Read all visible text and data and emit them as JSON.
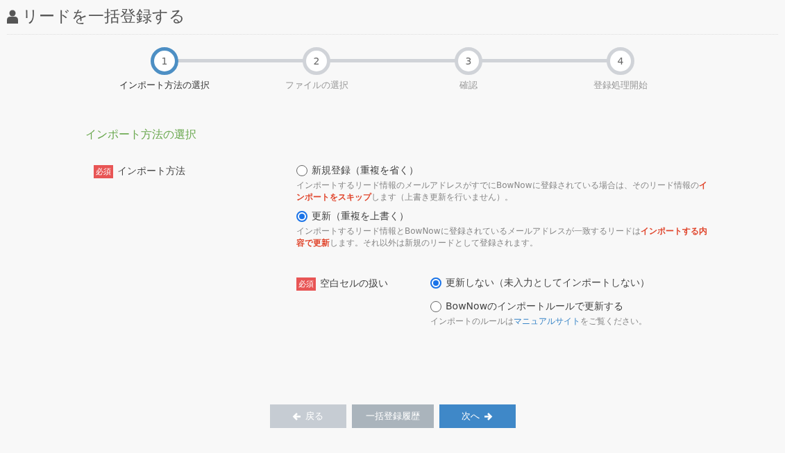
{
  "page_title": "リードを一括登録する",
  "steps": [
    {
      "number": "1",
      "label": "インポート方法の選択",
      "selected": true
    },
    {
      "number": "2",
      "label": "ファイルの選択",
      "selected": false
    },
    {
      "number": "3",
      "label": "確認",
      "selected": false
    },
    {
      "number": "4",
      "label": "登録処理開始",
      "selected": false
    }
  ],
  "section_title": "インポート方法の選択",
  "fields": [
    {
      "required_badge": "必須",
      "label": "インポート方法",
      "options": [
        {
          "label": "新規登録（重複を省く）",
          "selected": false,
          "description": "インポートするリード情報のメールアドレスがすでにBowNowに登録されている場合は、そのリード情報の**インポートをスキップ**します（上書き更新を行いません）。"
        },
        {
          "label": "更新（重複を上書く）",
          "selected": true,
          "description": "インポートするリード情報とBowNowに登録されているメールアドレスが一致するリードは**インポートする内容で更新**します。それ以外は新規のリードとして登録されます。"
        }
      ]
    },
    {
      "required_badge": "必須",
      "label": "空白セルの扱い",
      "options": [
        {
          "label": "更新しない（未入力としてインポートしない）",
          "selected": true
        },
        {
          "label": "BowNowのインポートルールで更新する",
          "selected": false,
          "note": {
            "before": "インポートのルールは",
            "link": "マニュアルサイト",
            "after": "をご覧ください。"
          }
        }
      ]
    }
  ],
  "buttons": [
    {
      "kind": "back",
      "label": "戻る",
      "disabled": true
    },
    {
      "kind": "history",
      "label": "一括登録履歴",
      "disabled": false
    },
    {
      "kind": "next",
      "label": "次へ",
      "disabled": false
    }
  ]
}
